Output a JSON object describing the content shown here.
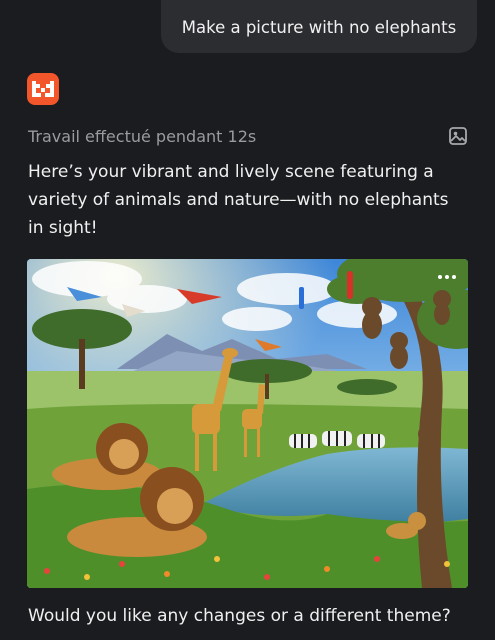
{
  "user_message": "Make a picture with no elephants",
  "assistant": {
    "status": "Travail effectué pendant 12s",
    "reply": "Here’s your vibrant and lively scene featuring a variety of animals and nature—with no elephants in sight!",
    "followup": "Would you like any changes or a different theme?"
  },
  "icons": {
    "logo": "mistral-m-logo",
    "status_icon": "image-icon",
    "image_menu": "more-icon"
  },
  "colors": {
    "background": "#1b1c1f",
    "bubble": "#2c2d31",
    "logo_accent": "#f2562a",
    "muted_text": "#9a9ba0"
  }
}
